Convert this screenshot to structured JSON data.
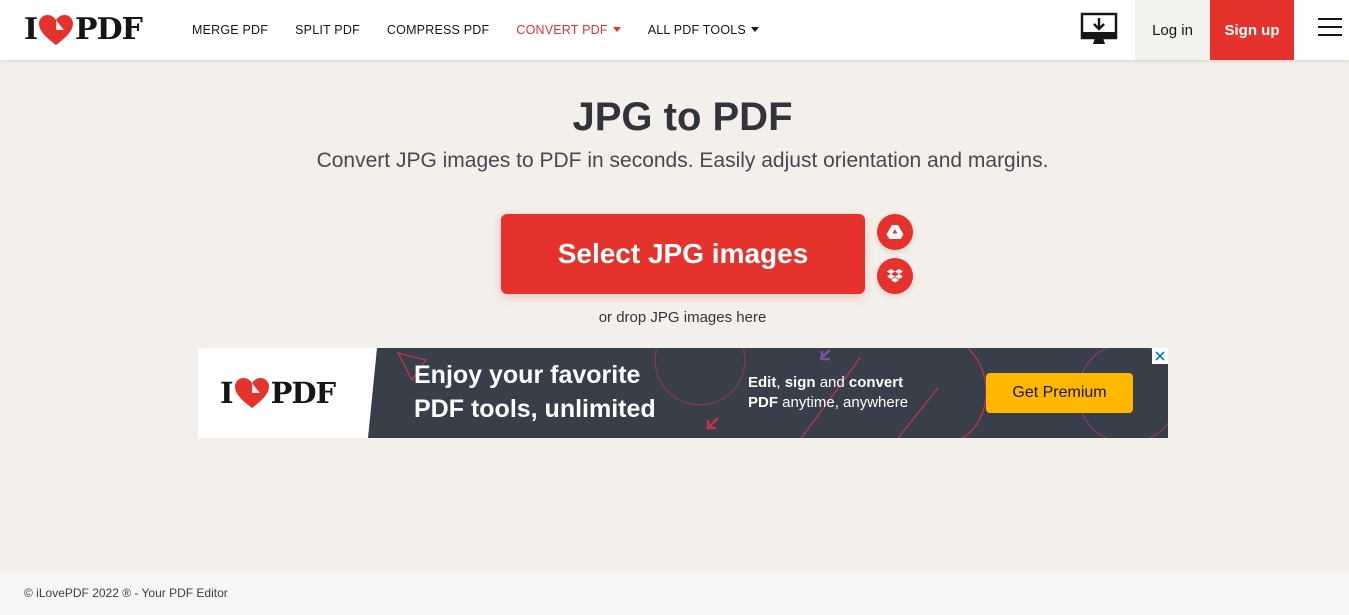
{
  "header": {
    "logo": {
      "left": "I",
      "right": "PDF",
      "icon": "heart-icon"
    },
    "nav": [
      {
        "label": "MERGE PDF",
        "active": false,
        "dropdown": false
      },
      {
        "label": "SPLIT PDF",
        "active": false,
        "dropdown": false
      },
      {
        "label": "COMPRESS PDF",
        "active": false,
        "dropdown": false
      },
      {
        "label": "CONVERT PDF",
        "active": true,
        "dropdown": true
      },
      {
        "label": "ALL PDF TOOLS",
        "active": false,
        "dropdown": true
      }
    ],
    "desktop_icon": "desktop-download-icon",
    "login_label": "Log in",
    "signup_label": "Sign up",
    "menu_icon": "hamburger-menu-icon"
  },
  "main": {
    "title": "JPG to PDF",
    "subtitle": "Convert JPG images to PDF in seconds. Easily adjust orientation and margins.",
    "select_label": "Select JPG images",
    "drop_text": "or drop JPG images here",
    "cloud_icons": [
      "google-drive-icon",
      "dropbox-icon"
    ]
  },
  "ad": {
    "logo": {
      "left": "I",
      "right": "PDF"
    },
    "headline_line1": "Enjoy your favorite",
    "headline_line2": "PDF tools, unlimited",
    "copy_edit": "Edit",
    "copy_comma": ",",
    "copy_sign": "sign",
    "copy_and": "and",
    "copy_convert": "convert",
    "copy_pdf": "PDF",
    "copy_rest": "anytime, anywhere",
    "cta_label": "Get Premium",
    "close_icon": "close-icon"
  },
  "footer": {
    "text": "© iLovePDF 2022 ® - Your PDF Editor"
  },
  "colors": {
    "brand_red": "#e5322d",
    "background": "#f3f0ec",
    "ad_bg": "#383e4a",
    "ad_cta": "#ffb700"
  }
}
